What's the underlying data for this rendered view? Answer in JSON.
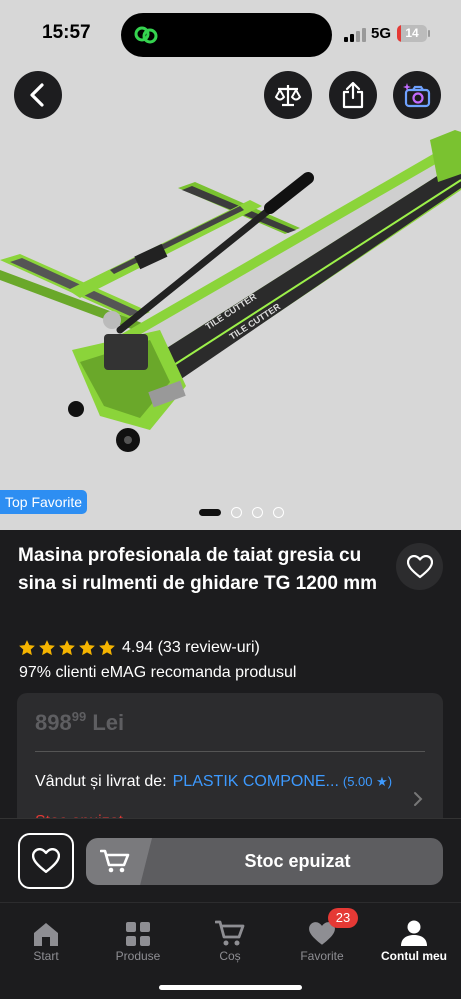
{
  "status_bar": {
    "time": "15:57",
    "network": "5G",
    "battery": "14",
    "battery_level_percent": 14
  },
  "header": {
    "back_icon": "chevron-left-icon",
    "compare_icon": "balance-scale-icon",
    "share_icon": "share-icon",
    "visual_search_icon": "camera-sparkle-icon"
  },
  "gallery": {
    "badge": "Top Favorite",
    "product_print": "TILE CUTTER",
    "slide_count": 4,
    "active_slide": 1
  },
  "product": {
    "title": "Masina profesionala de taiat gresia cu sina si rulmenti de ghidare TG 1200 mm",
    "rating_value": "4.94",
    "reviews": "(33 review-uri)",
    "stars": 5,
    "recommend": "97% clienti eMAG recomanda produsul"
  },
  "offer": {
    "price_main": "898",
    "price_cents": "99",
    "currency": "Lei",
    "seller_label": "Vândut și livrat de:",
    "seller_name": "PLASTIK COMPONE...",
    "seller_rating": "(5.00 ★)",
    "stock_peek": "Stoc epuizat"
  },
  "actions": {
    "cta_label": "Stoc epuizat"
  },
  "nav": {
    "items": [
      {
        "label": "Start",
        "icon": "home-icon"
      },
      {
        "label": "Produse",
        "icon": "grid-icon"
      },
      {
        "label": "Coș",
        "icon": "cart-icon"
      },
      {
        "label": "Favorite",
        "icon": "heart-icon",
        "badge": "23"
      },
      {
        "label": "Contul meu",
        "icon": "user-icon"
      }
    ]
  },
  "colors": {
    "accent_blue": "#3d9aff",
    "badge_blue": "#2d8ef2",
    "alert_red": "#e53935",
    "star_yellow": "#f5b400",
    "product_green": "#8bd43a"
  }
}
